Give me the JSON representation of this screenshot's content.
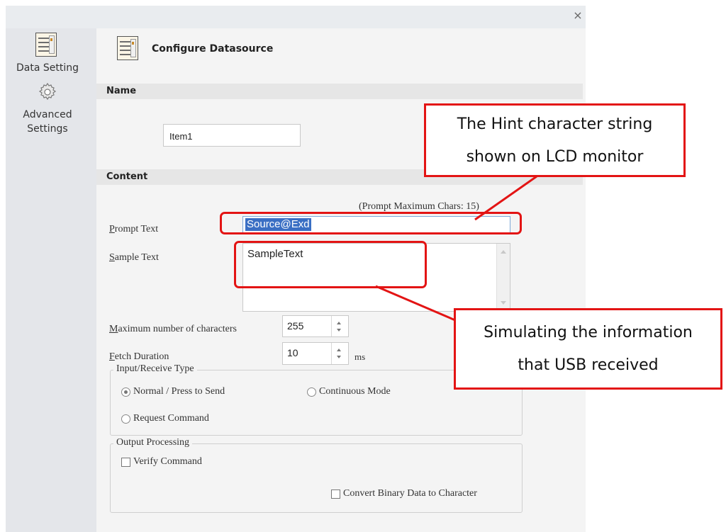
{
  "window": {
    "close_glyph": "×"
  },
  "sidebar": {
    "items": [
      {
        "label": "Data Setting",
        "icon": "data-sheet-icon"
      },
      {
        "label_line1": "Advanced",
        "label_line2": "Settings",
        "icon": "gear-icon"
      }
    ]
  },
  "header": {
    "title": "Configure Datasource",
    "icon": "data-sheet-icon"
  },
  "name_section": {
    "title": "Name",
    "value": "Item1"
  },
  "content_section": {
    "title": "Content",
    "prompt_max_note": "(Prompt Maximum Chars: 15)",
    "prompt_label": "Prompt Text",
    "prompt_value": "Source@Exd",
    "sample_label": "Sample Text",
    "sample_value": "SampleText",
    "max_chars_label": "Maximum number of characters",
    "max_chars_value": "255",
    "fetch_label": "Fetch Duration",
    "fetch_value": "10",
    "fetch_unit": "ms"
  },
  "input_type_group": {
    "title": "Input/Receive Type",
    "options": [
      {
        "label": "Normal / Press to Send",
        "selected": true
      },
      {
        "label": "Continuous Mode",
        "selected": false
      },
      {
        "label": "Request Command",
        "selected": false
      }
    ]
  },
  "output_group": {
    "title": "Output Processing",
    "verify_label": "Verify Command",
    "verify_checked": false,
    "convert_label": "Convert Binary Data to Character",
    "convert_checked": false
  },
  "annotations": {
    "hint_line1": "The Hint character string",
    "hint_line2": "shown on LCD monitor",
    "usb_line1": "Simulating the information",
    "usb_line2": "that USB received",
    "color": "#e31414"
  }
}
